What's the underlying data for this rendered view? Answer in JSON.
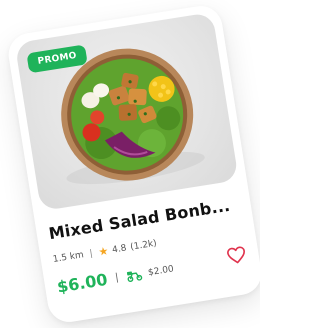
{
  "card": {
    "badge": "PROMO",
    "title": "Mixed Salad Bonb...",
    "distance": "1.5 km",
    "rating": "4.8",
    "reviews": "(1.2k)",
    "price": "$6.00",
    "delivery_fee": "$2.00"
  },
  "colors": {
    "accent": "#1fb35a",
    "star": "#f5a623",
    "heart": "#e0334d"
  },
  "icons": {
    "rating": "star-icon",
    "delivery": "delivery-scooter-icon",
    "favorite": "heart-icon"
  }
}
